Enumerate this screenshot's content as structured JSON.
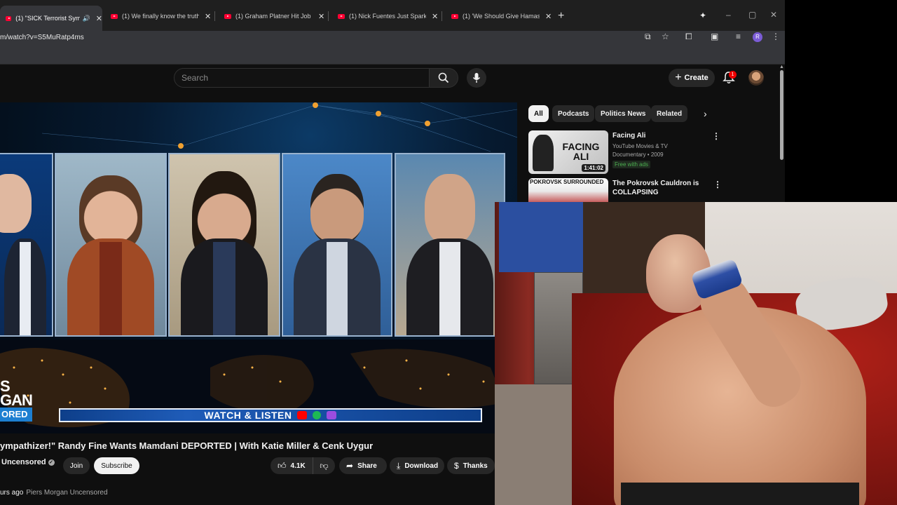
{
  "browser": {
    "tabs": [
      {
        "title": "(1) \"SICK Terrorist Sympath",
        "active": true,
        "audio": true
      },
      {
        "title": "(1) We finally know the truth..."
      },
      {
        "title": "(1) Graham Platner Hit Job BAC"
      },
      {
        "title": "(1) Nick Fuentes Just Sparked th"
      },
      {
        "title": "(1) 'We Should Give Hamas NU"
      }
    ],
    "new_tab": "+",
    "url": "m/watch?v=S5MuRatp4ms",
    "profile_initial": "R",
    "window_controls": [
      "–",
      "▢",
      "✕"
    ]
  },
  "header": {
    "search_placeholder": "Search",
    "create_label": "Create",
    "notifications_count": "1"
  },
  "video": {
    "brand_text": "S\nGAN",
    "brand_sub": "ORED",
    "watch_listen": "WATCH & LISTEN",
    "title": "ympathizer!\" Randy Fine Wants Mamdani DEPORTED | With Katie Miller & Cenk Uygur",
    "channel": "Uncensored",
    "join_label": "Join",
    "subscribe_label": "Subscribe",
    "likes": "4.1K",
    "share_label": "Share",
    "download_label": "Download",
    "thanks_label": "Thanks",
    "meta_time": "urs ago",
    "meta_desc": "Piers Morgan Uncensored"
  },
  "sidebar": {
    "chips": [
      {
        "label": "All",
        "active": true
      },
      {
        "label": "Podcasts"
      },
      {
        "label": "Politics News"
      },
      {
        "label": "Related"
      }
    ],
    "recommendations": [
      {
        "title": "Facing Ali",
        "channel": "YouTube Movies & TV",
        "details": "Documentary • 2009",
        "badge": "Free with ads",
        "duration": "1:41:02",
        "thumb_text": "FACING ALI"
      },
      {
        "title": "The Pokrovsk Cauldron is COLLAPSING",
        "thumb_text": "POKROVSK SURROUNDED"
      }
    ]
  },
  "colors": {
    "background": "#0f0f0f",
    "accent_red": "#ff0033",
    "chip_bg": "#272727"
  }
}
